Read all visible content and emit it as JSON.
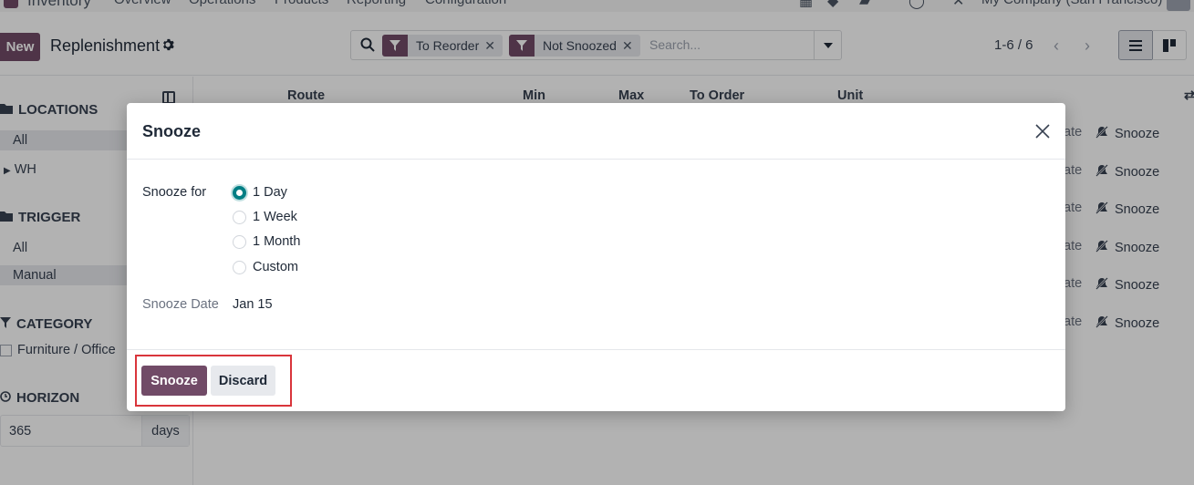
{
  "navbar": {
    "app_name": "Inventory",
    "menus": [
      "Overview",
      "Operations",
      "Products",
      "Reporting",
      "Configuration"
    ],
    "company": "My Company (San Francisco)"
  },
  "control_panel": {
    "new_label": "New",
    "title": "Replenishment",
    "facets": [
      "To Reorder",
      "Not Snoozed"
    ],
    "search_placeholder": "Search...",
    "pager": "1-6 / 6"
  },
  "sidebar": {
    "locations": {
      "title": "LOCATIONS",
      "items": [
        "All",
        "WH"
      ]
    },
    "trigger": {
      "title": "TRIGGER",
      "items": [
        "All",
        "Manual"
      ]
    },
    "category": {
      "title": "CATEGORY",
      "items": [
        "Furniture / Office"
      ]
    },
    "horizon": {
      "title": "HORIZON",
      "value": "365",
      "unit": "days"
    }
  },
  "list": {
    "columns": [
      "Route",
      "Min",
      "Max",
      "To Order",
      "Unit"
    ],
    "row_partial_label": "ate",
    "row_action": "Snooze",
    "row_count": 6
  },
  "dialog": {
    "title": "Snooze",
    "snooze_for_label": "Snooze for",
    "options": [
      "1 Day",
      "1 Week",
      "1 Month",
      "Custom"
    ],
    "selected_option": "1 Day",
    "snooze_date_label": "Snooze Date",
    "snooze_date_value": "Jan 15",
    "snooze_button": "Snooze",
    "discard_button": "Discard"
  },
  "colors": {
    "primary": "#714b67",
    "radio_accent": "#017e84",
    "highlight": "#d9353b"
  }
}
